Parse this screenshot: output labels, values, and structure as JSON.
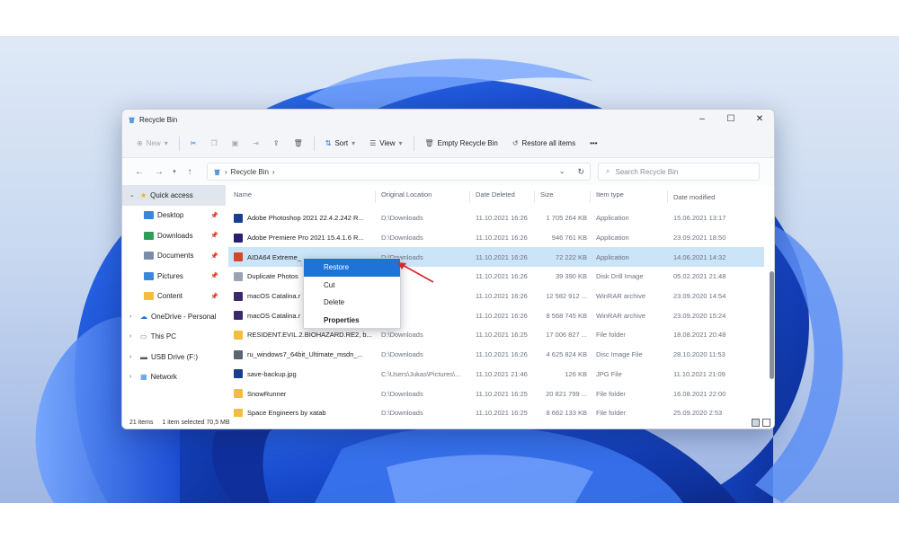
{
  "window": {
    "title": "Recycle Bin"
  },
  "titlebar": {
    "minimize": "–",
    "maximize": "☐",
    "close": "✕"
  },
  "toolbar": {
    "new_label": "New",
    "sort_label": "Sort",
    "view_label": "View",
    "empty_label": "Empty Recycle Bin",
    "restore_all_label": "Restore all items",
    "more_label": "•••"
  },
  "address": {
    "path": "Recycle Bin",
    "search_placeholder": "Search Recycle Bin"
  },
  "nav": {
    "quick_access": "Quick access",
    "items": [
      {
        "label": "Desktop",
        "color": "#3a86d9"
      },
      {
        "label": "Downloads",
        "color": "#2f9c58"
      },
      {
        "label": "Documents",
        "color": "#7a8da8"
      },
      {
        "label": "Pictures",
        "color": "#3a86d9"
      },
      {
        "label": "Content",
        "color": "#f2bd3c"
      }
    ],
    "onedrive": "OneDrive - Personal",
    "this_pc": "This PC",
    "usb": "USB Drive (F:)",
    "network": "Network"
  },
  "columns": [
    "Name",
    "Original Location",
    "Date Deleted",
    "Size",
    "Item type",
    "Date modified"
  ],
  "files": [
    {
      "name": "Adobe Photoshop 2021 22.4.2.242 R...",
      "location": "D:\\Downloads",
      "deleted": "11.10.2021 16:26",
      "size": "1 705 264 KB",
      "type": "Application",
      "modified": "15.06.2021 13:17",
      "icon": "#1b3d8f"
    },
    {
      "name": "Adobe Premiere Pro 2021 15.4.1.6 R...",
      "location": "D:\\Downloads",
      "deleted": "11.10.2021 16:26",
      "size": "946 761 KB",
      "type": "Application",
      "modified": "23.09.2021 18:50",
      "icon": "#2a1f6e"
    },
    {
      "name": "AIDA64 Extreme_",
      "location": "D:\\Downloads",
      "deleted": "11.10.2021 16:26",
      "size": "72 222 KB",
      "type": "Application",
      "modified": "14.06.2021 14:32",
      "icon": "#d9442b"
    },
    {
      "name": "Duplicate Photos",
      "location": "nloads",
      "deleted": "11.10.2021 16:26",
      "size": "39 390 KB",
      "type": "Disk Drill Image",
      "modified": "05.02.2021 21:48",
      "icon": "#9aa3af"
    },
    {
      "name": "macOS Catalina.r",
      "location": "nloads",
      "deleted": "11.10.2021 16:26",
      "size": "12 582 912 ...",
      "type": "WinRAR archive",
      "modified": "23.09.2020 14:54",
      "icon": "#3b2a6b"
    },
    {
      "name": "macOS Catalina.r",
      "location": "nloads",
      "deleted": "11.10.2021 16:26",
      "size": "8 568 745 KB",
      "type": "WinRAR archive",
      "modified": "23.09.2020 15:24",
      "icon": "#3b2a6b"
    },
    {
      "name": "RESIDENT.EVIL.2.BIOHAZARD.RE2, b...",
      "location": "D:\\Downloads",
      "deleted": "11.10.2021 16:25",
      "size": "17 006 827 ...",
      "type": "File folder",
      "modified": "18.08.2021 20:48",
      "icon": "#f2bd3c"
    },
    {
      "name": "ru_windows7_64bit_Ultimate_msdn_...",
      "location": "D:\\Downloads",
      "deleted": "11.10.2021 16:26",
      "size": "4 625 824 KB",
      "type": "Disc Image File",
      "modified": "28.10.2020 11:53",
      "icon": "#5c6470"
    },
    {
      "name": "save-backup.jpg",
      "location": "C:\\Users\\Jukas\\Pictures\\...",
      "deleted": "11.10.2021 21:46",
      "size": "126 KB",
      "type": "JPG File",
      "modified": "11.10.2021 21:09",
      "icon": "#1b3d8f"
    },
    {
      "name": "SnowRunner",
      "location": "D:\\Downloads",
      "deleted": "11.10.2021 16:25",
      "size": "20 821 799 ...",
      "type": "File folder",
      "modified": "16.08.2021 22:00",
      "icon": "#f2bd3c"
    },
    {
      "name": "Space Engineers by xatab",
      "location": "D:\\Downloads",
      "deleted": "11.10.2021 16:25",
      "size": "8 662 133 KB",
      "type": "File folder",
      "modified": "25.09.2020 2:53",
      "icon": "#f2bd3c"
    }
  ],
  "selected_row": 2,
  "status": {
    "count": "21 items",
    "selection": "1 item selected  70,5 MB"
  },
  "context_menu": {
    "restore": "Restore",
    "cut": "Cut",
    "delete": "Delete",
    "properties": "Properties"
  },
  "colors": {
    "accent": "#1e73d8",
    "selection": "#cce4f7",
    "annotation_arrow": "#d9262e"
  }
}
